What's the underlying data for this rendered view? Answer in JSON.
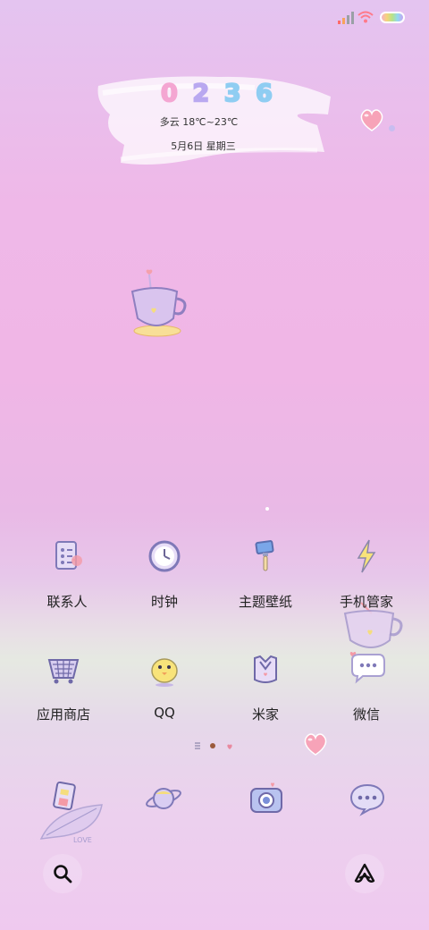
{
  "status_bar": {
    "signal_icon": "signal-icon",
    "wifi_icon": "wifi-icon",
    "battery_icon": "battery-icon"
  },
  "clock_widget": {
    "digits": [
      "0",
      "2",
      "3",
      "6"
    ],
    "weather": "多云 18℃~23℃",
    "date": "5月6日 星期三"
  },
  "apps": [
    {
      "label": "联系人",
      "icon": "contacts-icon"
    },
    {
      "label": "时钟",
      "icon": "clock-icon"
    },
    {
      "label": "主题壁纸",
      "icon": "theme-brush-icon"
    },
    {
      "label": "手机管家",
      "icon": "lightning-icon"
    },
    {
      "label": "应用商店",
      "icon": "basket-icon"
    },
    {
      "label": "QQ",
      "icon": "chick-icon"
    },
    {
      "label": "米家",
      "icon": "mijia-icon"
    },
    {
      "label": "微信",
      "icon": "chat-bubble-icon"
    }
  ],
  "page_indicator": {
    "pages": 3,
    "current": 2
  },
  "dock": [
    "phone-doodle-icon",
    "planet-icon",
    "camera-icon",
    "message-icon"
  ],
  "decoration": {
    "leaf_text": "LOVE"
  },
  "bottom_bar": {
    "search_icon": "search-icon",
    "assistant_icon": "assistant-icon"
  },
  "colors": {
    "digit_pink": "#f4a6d2",
    "digit_purple": "#b9a8f0",
    "digit_blue": "#8fcdf2",
    "accent_purple": "#8a7fc4"
  }
}
